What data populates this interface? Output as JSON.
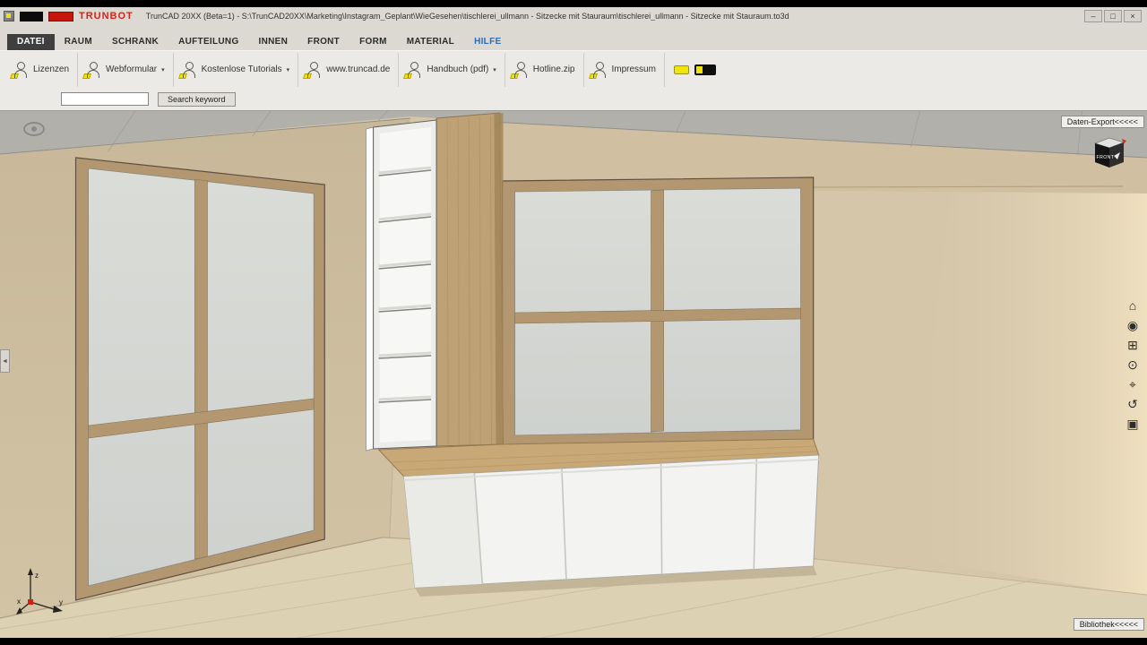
{
  "colors": {
    "accent_yellow": "#f2e400",
    "menu_highlight_blue": "#2a6dbd",
    "brand_red": "#d2261a",
    "wall_beige": "#d5c6a9",
    "wood_oak": "#bfa176",
    "floor_wood": "#ddd1b4",
    "glass_gray": "#d6d8d4",
    "ceiling_gray": "#b2b0ab"
  },
  "titlebar": {
    "brand": "TRUNBOT",
    "title": "TrunCAD 20XX (Beta=1)  - S:\\TrunCAD20XX\\Marketing\\Instagram_Geplant\\WieGesehen\\tischlerei_ullmann - Sitzecke mit Stauraum\\tischlerei_ullmann - Sitzecke mit Stauraum.to3d",
    "controls": {
      "minimize": "–",
      "maximize": "□",
      "close": "×"
    }
  },
  "menu": {
    "items": [
      {
        "label": "DATEI"
      },
      {
        "label": "RAUM"
      },
      {
        "label": "SCHRANK"
      },
      {
        "label": "AUFTEILUNG"
      },
      {
        "label": "INNEN"
      },
      {
        "label": "FRONT"
      },
      {
        "label": "FORM"
      },
      {
        "label": "MATERIAL"
      },
      {
        "label": "HILFE"
      }
    ]
  },
  "ribbon": {
    "buttons": [
      {
        "label": "Lizenzen"
      },
      {
        "label": "Webformular"
      },
      {
        "label": "Kostenlose Tutorials"
      },
      {
        "label": "www.truncad.de"
      },
      {
        "label": "Handbuch (pdf)"
      },
      {
        "label": "Hotline.zip"
      },
      {
        "label": "Impressum"
      }
    ]
  },
  "icons": {
    "caret": "▾",
    "collapse_left": "◄",
    "home": "⌂",
    "eye": "◉",
    "zoom_window": "⊞",
    "zoom": "⊙",
    "pan": "⌖",
    "rotate": "↺",
    "fit": "▣"
  },
  "search": {
    "value": "",
    "button_label": "Search keyword"
  },
  "viewport": {
    "export_button_label": "Daten-Export<<<<<",
    "library_button_label": "Bibliothek<<<<<",
    "orientation_cube_label": "FRONT",
    "axis_labels": {
      "x": "x",
      "y": "y",
      "z": "z"
    }
  }
}
